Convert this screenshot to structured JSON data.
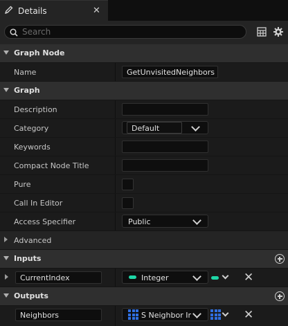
{
  "tab": {
    "title": "Details"
  },
  "search": {
    "placeholder": "Search"
  },
  "sections": {
    "graph_node": "Graph Node",
    "graph": "Graph",
    "advanced": "Advanced",
    "inputs": "Inputs",
    "outputs": "Outputs"
  },
  "graph_node": {
    "name_label": "Name",
    "name_value": "GetUnvisitedNeighbors"
  },
  "graph": {
    "description_label": "Description",
    "description_value": "",
    "category_label": "Category",
    "category_value": "Default",
    "keywords_label": "Keywords",
    "keywords_value": "",
    "compact_title_label": "Compact Node Title",
    "compact_title_value": "",
    "pure_label": "Pure",
    "call_in_editor_label": "Call In Editor",
    "access_label": "Access Specifier",
    "access_value": "Public"
  },
  "inputs": [
    {
      "name": "CurrentIndex",
      "type": "Integer",
      "pin_color": "#1ed6a6"
    }
  ],
  "outputs": [
    {
      "name": "Neighbors",
      "type": "S Neighbor Info",
      "pin_color": "#2f6fe0"
    }
  ]
}
